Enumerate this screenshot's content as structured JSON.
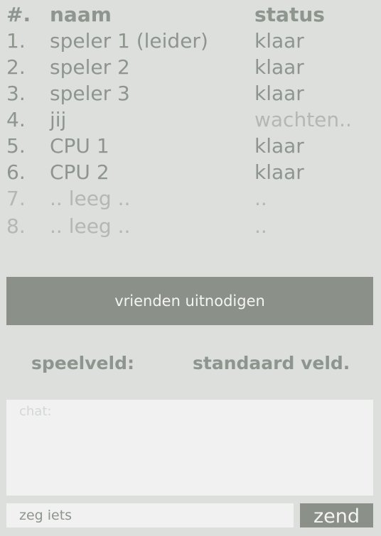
{
  "table": {
    "header": {
      "num": "#.",
      "name": "naam",
      "status": "status"
    },
    "rows": [
      {
        "num": "1.",
        "name": "speler 1 (leider)",
        "status": "klaar"
      },
      {
        "num": "2.",
        "name": "speler 2",
        "status": "klaar"
      },
      {
        "num": "3.",
        "name": "speler 3",
        "status": "klaar"
      },
      {
        "num": "4.",
        "name": "jij",
        "status": "wachten.."
      },
      {
        "num": "5.",
        "name": "CPU 1",
        "status": "klaar"
      },
      {
        "num": "6.",
        "name": "CPU 2",
        "status": "klaar"
      },
      {
        "num": "7.",
        "name": ".. leeg ..",
        "status": ".."
      },
      {
        "num": "8.",
        "name": ".. leeg ..",
        "status": ".."
      }
    ]
  },
  "invite_label": "vrienden uitnodigen",
  "field": {
    "label": "speelveld:",
    "value": "standaard veld."
  },
  "chat": {
    "placeholder": "chat:"
  },
  "message": {
    "value": "zeg iets"
  },
  "send_label": "zend",
  "colors": {
    "background": "#dcdfdc",
    "button": "#8b9189",
    "text": "#8e958e",
    "muted": "#b3b8b3",
    "panel": "#f0f1f0"
  }
}
